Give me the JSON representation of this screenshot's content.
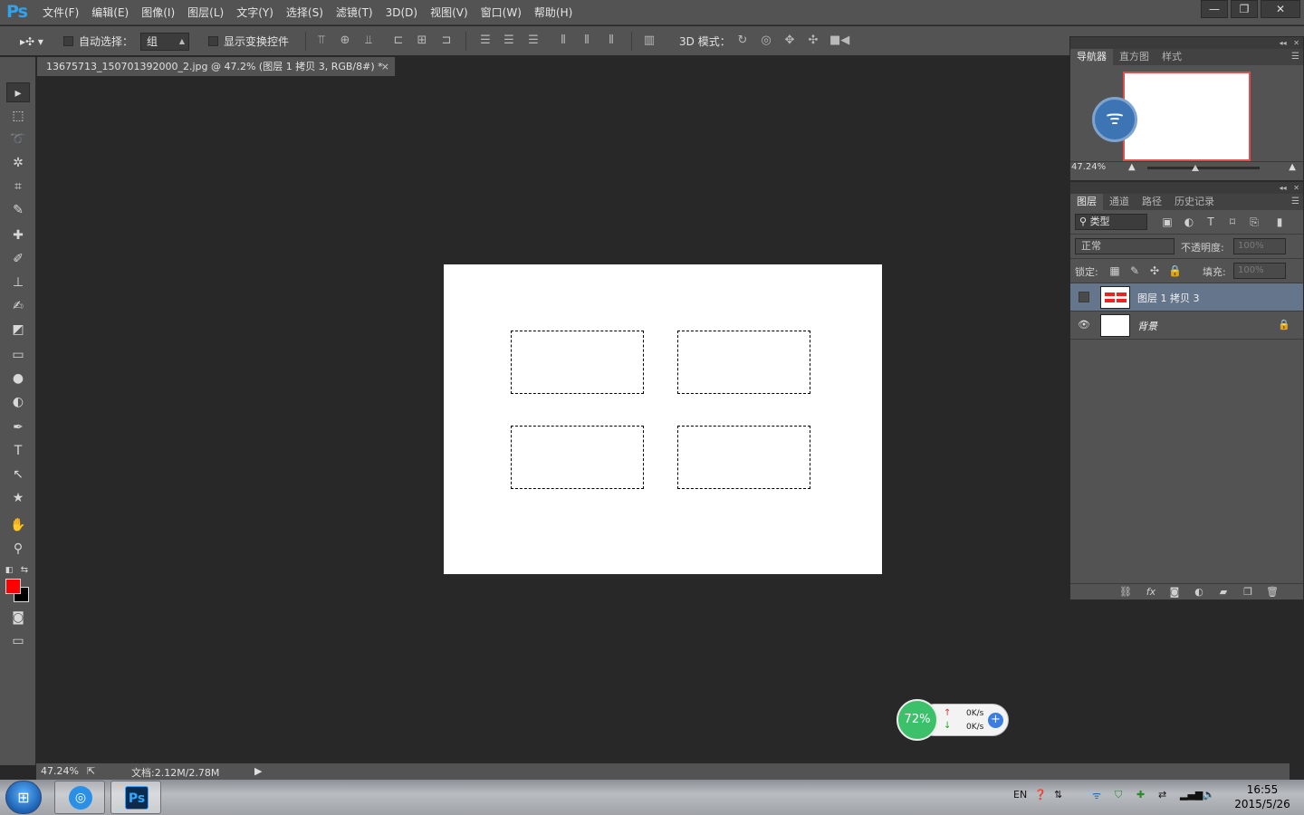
{
  "app": {
    "logo": "Ps"
  },
  "menu": [
    "文件(F)",
    "编辑(E)",
    "图像(I)",
    "图层(L)",
    "文字(Y)",
    "选择(S)",
    "滤镜(T)",
    "3D(D)",
    "视图(V)",
    "窗口(W)",
    "帮助(H)"
  ],
  "window_controls": {
    "minimize": "—",
    "restore": "❐",
    "close": "✕"
  },
  "options": {
    "auto_select_label": "自动选择：",
    "auto_select_value": "组",
    "show_transform_label": "显示变换控件",
    "mode_3d_label": "3D 模式："
  },
  "document": {
    "tab_title": "13675713_150701392000_2.jpg @ 47.2% (图层 1 拷贝 3, RGB/8#) *",
    "tab_close": "×"
  },
  "status": {
    "zoom": "47.24%",
    "doc_info": "文档:2.12M/2.78M"
  },
  "navigator": {
    "tabs": [
      "导航器",
      "直方图",
      "样式"
    ],
    "zoom": "47.24%"
  },
  "layers_panel": {
    "tabs": [
      "图层",
      "通道",
      "路径",
      "历史记录"
    ],
    "filter_label": "类型",
    "blend_mode": "正常",
    "opacity_label": "不透明度:",
    "opacity_value": "100%",
    "lock_label": "锁定:",
    "fill_label": "填充:",
    "fill_value": "100%",
    "layers": [
      {
        "name": "图层 1 拷贝 3",
        "visible": false,
        "selected": true
      },
      {
        "name": "背景",
        "visible": true,
        "selected": false,
        "locked": true
      }
    ]
  },
  "net_widget": {
    "percent": "72%",
    "upload": "0K/s",
    "download": "0K/s"
  },
  "taskbar": {
    "lang": "EN",
    "time": "16:55",
    "date": "2015/5/26",
    "ps_label": "Ps"
  },
  "colors": {
    "foreground": "#ff0000",
    "background": "#000000",
    "accent": "#2fa3f0"
  }
}
